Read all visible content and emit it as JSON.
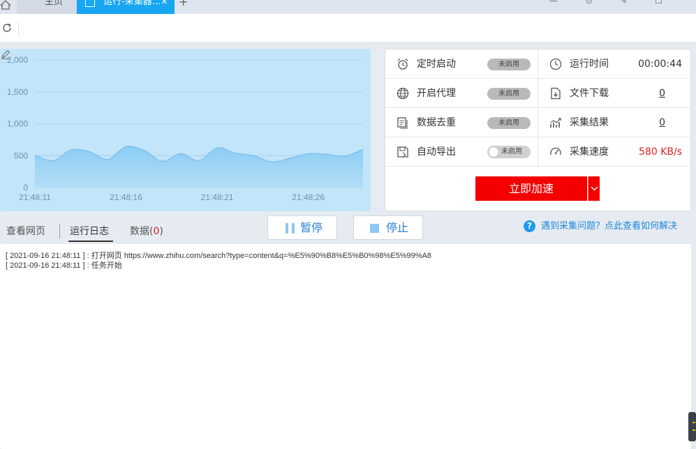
{
  "tabs": {
    "home_label": "主页",
    "active_label": "运行-采集器...",
    "close_symbol": "×",
    "add_symbol": "+",
    "window_controls": "— ⊙ ✎ ☐"
  },
  "chart_data": {
    "type": "area",
    "x": [
      "21:48:11",
      "21:48:12",
      "21:48:13",
      "21:48:14",
      "21:48:15",
      "21:48:16",
      "21:48:17",
      "21:48:18",
      "21:48:19",
      "21:48:20",
      "21:48:21",
      "21:48:22",
      "21:48:23",
      "21:48:24",
      "21:48:25",
      "21:48:26",
      "21:48:27",
      "21:48:28",
      "21:48:29"
    ],
    "values": [
      510,
      420,
      590,
      560,
      440,
      640,
      580,
      410,
      530,
      420,
      620,
      540,
      500,
      400,
      460,
      530,
      520,
      490,
      600
    ],
    "xticks": [
      "21:48:11",
      "21:48:16",
      "21:48:21",
      "21:48:26"
    ],
    "yticks": [
      "2,000",
      "1,500",
      "1,000",
      "500",
      "0"
    ],
    "ylim": [
      0,
      2000
    ],
    "grid": true,
    "colors": {
      "fill": "#8ccdf3",
      "line": "#7cc3f0",
      "axis_text": "#6a8fb5",
      "grid": "#a9d3ef"
    }
  },
  "settings": {
    "timed_start": {
      "label": "定时启动",
      "status": "未启用"
    },
    "run_time": {
      "label": "运行时间",
      "value": "00:00:44"
    },
    "proxy": {
      "label": "开启代理",
      "status": "未启用"
    },
    "file_download": {
      "label": "文件下载",
      "value": "0"
    },
    "dedupe": {
      "label": "数据去重",
      "status": "未启用"
    },
    "results": {
      "label": "采集结果",
      "value": "0"
    },
    "auto_export": {
      "label": "自动导出",
      "status": "未启用"
    },
    "speed": {
      "label": "采集速度",
      "value": "580 KB/s"
    },
    "boost_label": "立即加速",
    "dropdown_symbol": "﹀"
  },
  "view_tabs": {
    "webpage": "查看网页",
    "log": "运行日志",
    "data_prefix": "数据(",
    "data_count": "0",
    "data_suffix": ")"
  },
  "controls": {
    "pause_label": "暂停",
    "stop_label": "停止"
  },
  "help": {
    "icon": "?",
    "text": "遇到采集问题？点此查看如何解决"
  },
  "log": [
    "[ 2021-09-16 21:48:11 ] : 打开网页 https://www.zhihu.com/search?type=content&q=%E5%90%B8%E5%B0%98%E5%99%A8",
    "[ 2021-09-16 21:48:11 ] : 任务开始"
  ],
  "colors": {
    "accent_blue": "#16a6f2",
    "boost_red": "#f50000",
    "link_blue": "#1e88d9",
    "value_red": "#e02020"
  }
}
